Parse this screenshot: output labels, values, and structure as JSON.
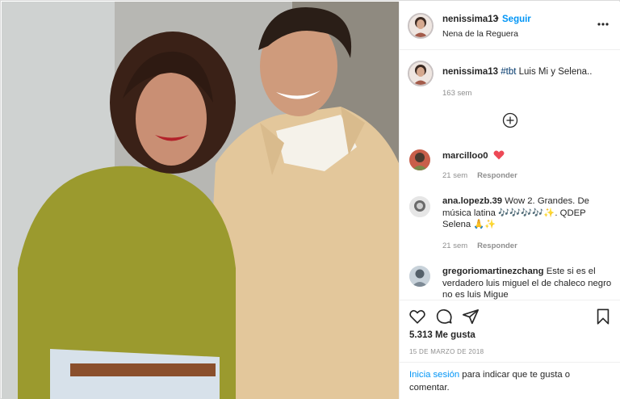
{
  "post": {
    "username": "nenissima13",
    "follow_label": "Seguir",
    "dot": "•",
    "location": "Nena de la Reguera"
  },
  "caption": {
    "username": "nenissima13",
    "hashtag": "#tbt",
    "text": " Luis Mi y Selena..",
    "time": "163 sem"
  },
  "comments": [
    {
      "username": "marcilloo0",
      "text": "",
      "time": "21 sem",
      "reply_label": "Responder",
      "heart_color": "#ed4956"
    },
    {
      "username": "ana.lopezb.39",
      "text": "Wow 2. Grandes. De música latina 🎶🎶🎶🎶✨. QDEP Selena 🙏✨",
      "time": "21 sem",
      "reply_label": "Responder"
    },
    {
      "username": "gregoriomartinezchang",
      "text": "Este si es el verdadero luis miguel el de chaleco negro no es luis Migue",
      "time": "",
      "reply_label": ""
    }
  ],
  "actions": {
    "likes": "5.313 Me gusta",
    "date": "15 DE MARZO DE 2018",
    "login_link": "Inicia sesión",
    "login_text": " para indicar que te gusta o comentar."
  },
  "icons": [
    "heart-icon",
    "comment-icon",
    "share-icon",
    "bookmark-icon",
    "more-icon",
    "plus-circle-icon"
  ],
  "colors": {
    "link": "#0095f6",
    "hashtag": "#00376b",
    "muted": "#8e8e8e",
    "text": "#262626"
  }
}
